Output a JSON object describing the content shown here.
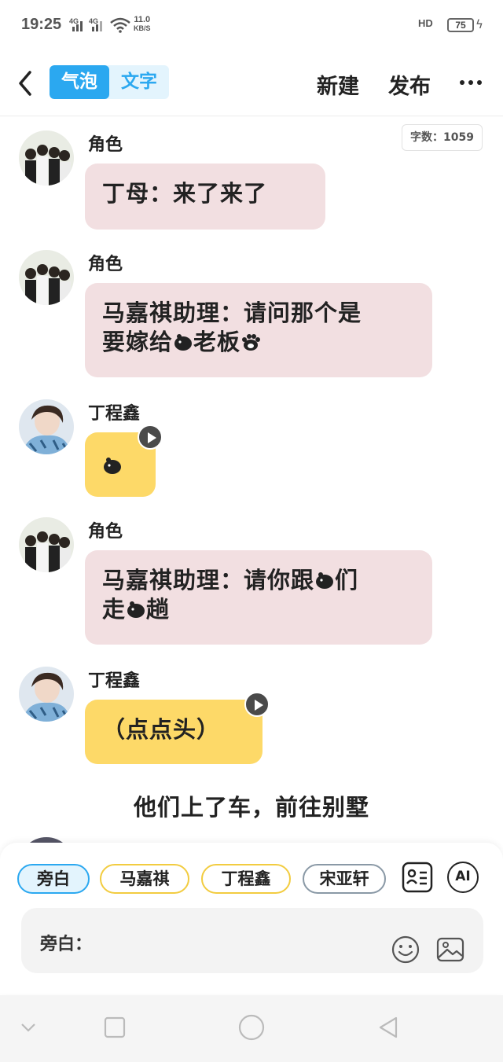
{
  "status_bar": {
    "time": "19:25",
    "net1": "4G",
    "net2": "4G",
    "speed_value": "11.0",
    "speed_unit": "KB/S",
    "hd": "HD",
    "battery": "75"
  },
  "header": {
    "mode_active": "气泡",
    "mode_inactive": "文字",
    "new_label": "新建",
    "publish_label": "发布"
  },
  "word_count": "字数：1059",
  "messages": [
    {
      "name": "角色",
      "text": "丁母：来了来了"
    },
    {
      "name": "角色",
      "text_line1": "马嘉祺助理：请问那个是",
      "text_line2_a": "要嫁给",
      "text_line2_b": "老板"
    },
    {
      "name": "丁程鑫"
    },
    {
      "name": "角色",
      "text_line1_a": "马嘉祺助理：请你跟",
      "text_line1_b": "们",
      "text_line2_a": "走",
      "text_line2_b": "趟"
    },
    {
      "name": "丁程鑫",
      "text": "（点点头）"
    }
  ],
  "narration": "他们上了车，前往别墅",
  "composer": {
    "chips": [
      "旁白",
      "马嘉祺",
      "丁程鑫",
      "宋亚轩"
    ],
    "ai_label": "AI",
    "input_label": "旁白：",
    "input_value": ""
  },
  "colors": {
    "accent": "#2ba8f0",
    "pink_bubble": "#f2dfe1",
    "yellow_bubble": "#fdd968"
  },
  "icons": [
    "back-icon",
    "more-icon",
    "play-icon",
    "character-card-icon",
    "smiley-icon",
    "image-icon"
  ]
}
